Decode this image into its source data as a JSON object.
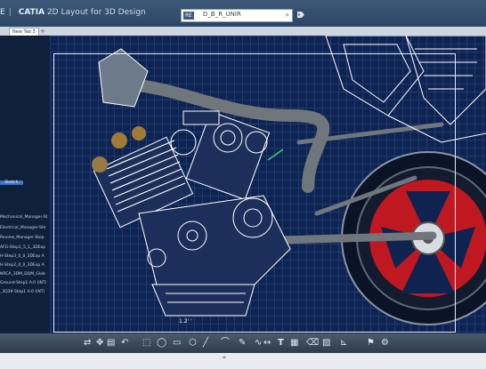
{
  "app": {
    "left_glyph": "E",
    "brand": "CATIA",
    "subtitle": "2D Layout for 3D Design"
  },
  "search": {
    "tag": "RE",
    "value": "D_B_R_UNIR",
    "icon": "search-icon"
  },
  "tabs": [
    {
      "label": "New Tab 3"
    },
    {
      "label": "+"
    }
  ],
  "sidebar": {
    "items": [
      {
        "label": "...Sketch..."
      },
      {
        "label": "Mechanical_Manager-St"
      },
      {
        "label": "Electrical_Manager-Ste"
      },
      {
        "label": "Review_Manager-Step"
      },
      {
        "label": "AFG-Step1_5_1_3DExp"
      },
      {
        "label": "H-Step3_0_0_3DExp A"
      },
      {
        "label": "H-Step2_0_0_3DExp A"
      },
      {
        "label": "NRCA_3DM_DQM_Glob"
      },
      {
        "label": "Ground-Step1 A.0 (INT)"
      },
      {
        "label": "_3Q39-Step1 A.0 (INT)"
      }
    ]
  },
  "canvas": {
    "annotation": "1.2' '"
  },
  "colors": {
    "background": "#0f2350",
    "grid": "#203a70",
    "wireframe": "#ffffff",
    "frame_tube": "#6f777d",
    "wheel_red": "#c01820"
  },
  "toolbar": {
    "icons": [
      "arrows-icon",
      "pan-icon",
      "paste-icon",
      "undo-icon",
      "select-icon",
      "circle-icon",
      "rectangle-icon",
      "polygon-icon",
      "line-icon",
      "arc-icon",
      "pen-icon",
      "spline-icon",
      "dimension-icon",
      "text-icon",
      "table-icon",
      "erase-icon",
      "hatch-icon",
      "measure-icon",
      "annotation-icon"
    ],
    "text_tool": "T"
  }
}
